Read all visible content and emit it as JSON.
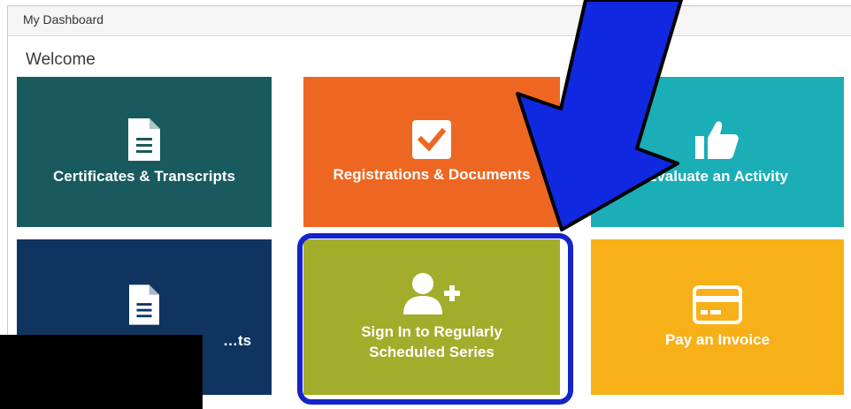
{
  "panel": {
    "title": "My Dashboard"
  },
  "welcome": "Welcome",
  "tiles": [
    {
      "label": "Certificates & Transcripts",
      "icon": "document-icon",
      "color": "#195a5e"
    },
    {
      "label": "Registrations & Documents",
      "icon": "checkbox-icon",
      "color": "#ee6722"
    },
    {
      "label": "Evaluate an Activity",
      "icon": "thumbs-up-icon",
      "color": "#1caeb6"
    },
    {
      "label": "…ts",
      "icon": "document-icon",
      "color": "#0f3460"
    },
    {
      "label_line1": "Sign In to Regularly",
      "label_line2": "Scheduled Series",
      "icon": "user-plus-icon",
      "color": "#a2ad2b"
    },
    {
      "label": "Pay an Invoice",
      "icon": "credit-card-icon",
      "color": "#f8b019"
    }
  ],
  "annotations": {
    "highlight_color": "#1424c8",
    "arrow_color": "#1028e0"
  }
}
